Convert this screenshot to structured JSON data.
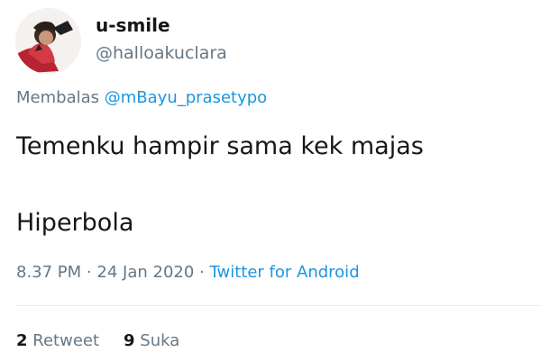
{
  "user": {
    "display_name": "u-smile",
    "handle": "@halloakuclara"
  },
  "reply": {
    "prefix": "Membalas",
    "mention": "@mBayu_prasetypo"
  },
  "tweet": {
    "line1": "Temenku hampir sama kek majas",
    "line2": "Hiperbola"
  },
  "meta": {
    "time": "8.37 PM",
    "date": "24 Jan 2020",
    "source": "Twitter for Android",
    "separator": "·"
  },
  "stats": {
    "retweet_count": "2",
    "retweet_label": "Retweet",
    "like_count": "9",
    "like_label": "Suka"
  },
  "colors": {
    "text_primary": "#14171a",
    "text_secondary": "#657786",
    "link": "#1b95e0",
    "divider": "#e6ecf0"
  }
}
